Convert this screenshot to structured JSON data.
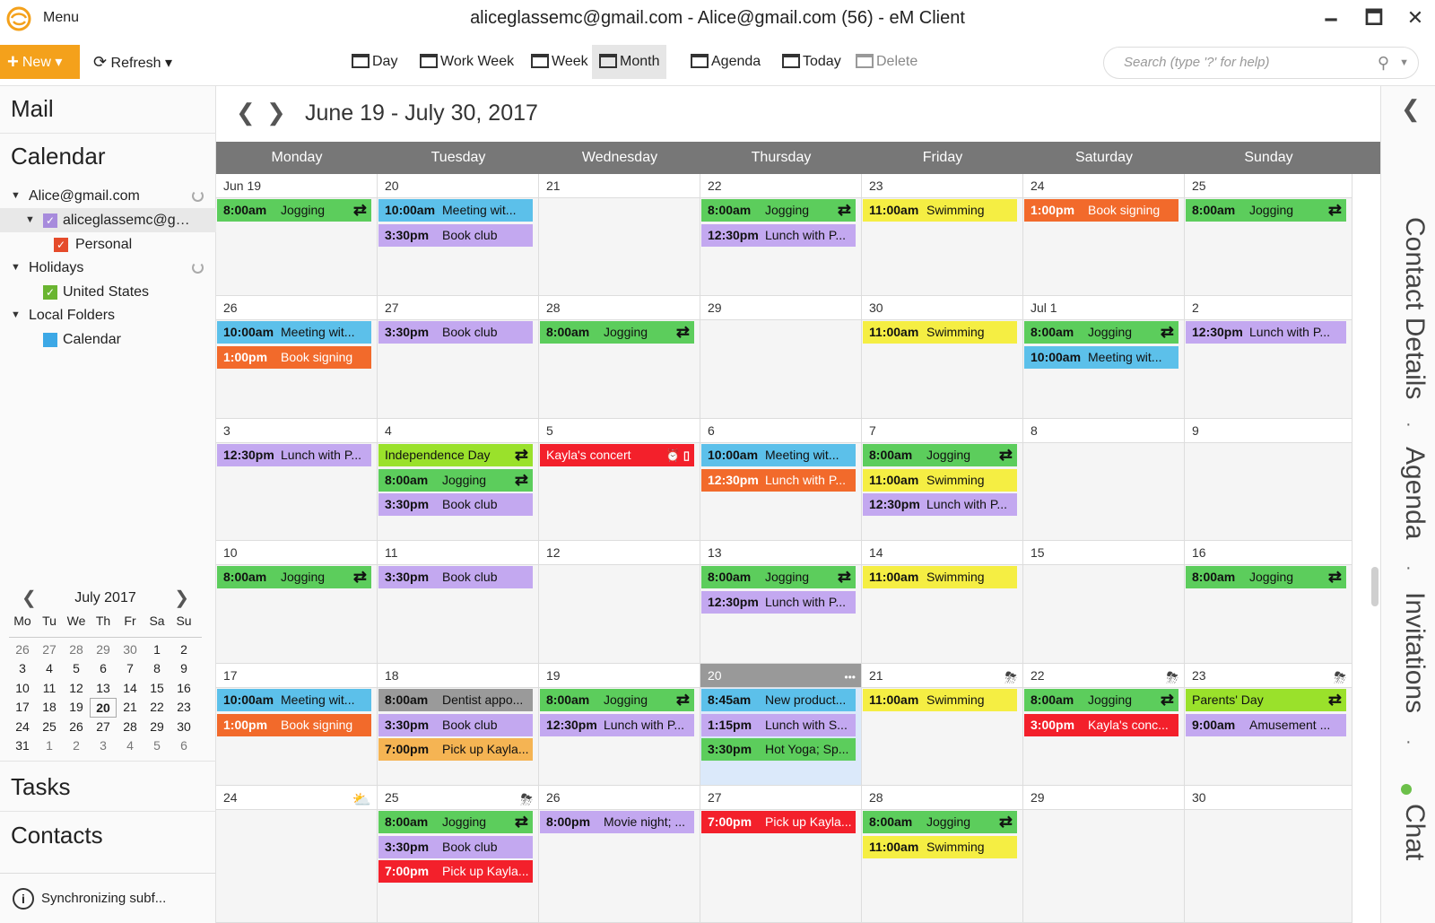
{
  "titlebar": {
    "menu": "Menu",
    "title": "aliceglassemc@gmail.com - Alice@gmail.com (56) - eM Client",
    "minimize": "🗕",
    "maximize": "🗖",
    "close": "✕"
  },
  "toolbar": {
    "new": "New",
    "refresh": "Refresh",
    "views": [
      {
        "label": "Day",
        "active": false
      },
      {
        "label": "Work Week",
        "active": false
      },
      {
        "label": "Week",
        "active": false
      },
      {
        "label": "Month",
        "active": true
      },
      {
        "label": "Agenda",
        "active": false
      },
      {
        "label": "Today",
        "active": false
      },
      {
        "label": "Delete",
        "active": false,
        "disabled": true
      }
    ],
    "search_placeholder": "Search (type '?' for help)"
  },
  "sidebar": {
    "mail": "Mail",
    "calendar": "Calendar",
    "tasks": "Tasks",
    "contacts": "Contacts",
    "tree": [
      {
        "label": "Alice@gmail.com",
        "level": 0,
        "expander": true,
        "spinner": true
      },
      {
        "label": "aliceglassemc@gmail.com",
        "level": 1,
        "expander": true,
        "check": "#a78bdc",
        "selected": true
      },
      {
        "label": "Personal",
        "level": 2,
        "check": "#e54b2b"
      },
      {
        "label": "Holidays",
        "level": 0,
        "expander": true,
        "spinner": true
      },
      {
        "label": "United States",
        "level": 1,
        "check": "#6ab531"
      },
      {
        "label": "Local Folders",
        "level": 0,
        "expander": true
      },
      {
        "label": "Calendar",
        "level": 1,
        "square": "#3ca8e6"
      }
    ],
    "status": "Synchronizing subf...",
    "mini": {
      "title": "July 2017",
      "dow": [
        "Mo",
        "Tu",
        "We",
        "Th",
        "Fr",
        "Sa",
        "Su"
      ],
      "days": [
        "26",
        "27",
        "28",
        "29",
        "30",
        "1",
        "2",
        "3",
        "4",
        "5",
        "6",
        "7",
        "8",
        "9",
        "10",
        "11",
        "12",
        "13",
        "14",
        "15",
        "16",
        "17",
        "18",
        "19",
        "20",
        "21",
        "22",
        "23",
        "24",
        "25",
        "26",
        "27",
        "28",
        "29",
        "30",
        "31",
        "1",
        "2",
        "3",
        "4",
        "5",
        "6"
      ],
      "other_before": 5,
      "other_after_index": 36,
      "today_index": 24
    }
  },
  "calendar": {
    "range": "June 19 - July 30, 2017",
    "dow": [
      "Monday",
      "Tuesday",
      "Wednesday",
      "Thursday",
      "Friday",
      "Saturday",
      "Sunday"
    ],
    "colors": {
      "green": "#5ccd5c",
      "blue": "#5cc0ea",
      "purple": "#c3a8f0",
      "yellow": "#f5ee43",
      "orange": "#f26a2b",
      "red": "#f3202b",
      "lime": "#9ae12b",
      "gray": "#9a9a9a",
      "peach": "#f5b453"
    },
    "weeks": [
      [
        {
          "d": "Jun 19",
          "ev": [
            {
              "t": "8:00am",
              "x": "Jogging",
              "c": "green",
              "r": 1
            }
          ]
        },
        {
          "d": "20",
          "ev": [
            {
              "t": "10:00am",
              "x": "Meeting wit...",
              "c": "blue"
            },
            {
              "t": "3:30pm",
              "x": "Book club",
              "c": "purple"
            }
          ]
        },
        {
          "d": "21",
          "ev": []
        },
        {
          "d": "22",
          "ev": [
            {
              "t": "8:00am",
              "x": "Jogging",
              "c": "green",
              "r": 1
            },
            {
              "t": "12:30pm",
              "x": "Lunch with P...",
              "c": "purple"
            }
          ]
        },
        {
          "d": "23",
          "ev": [
            {
              "t": "11:00am",
              "x": "Swimming",
              "c": "yellow"
            }
          ]
        },
        {
          "d": "24",
          "ev": [
            {
              "t": "1:00pm",
              "x": "Book signing",
              "c": "orange"
            }
          ]
        },
        {
          "d": "25",
          "ev": [
            {
              "t": "8:00am",
              "x": "Jogging",
              "c": "green",
              "r": 1
            }
          ]
        }
      ],
      [
        {
          "d": "26",
          "ev": [
            {
              "t": "10:00am",
              "x": "Meeting wit...",
              "c": "blue"
            },
            {
              "t": "1:00pm",
              "x": "Book signing",
              "c": "orange"
            }
          ]
        },
        {
          "d": "27",
          "ev": [
            {
              "t": "3:30pm",
              "x": "Book club",
              "c": "purple"
            }
          ]
        },
        {
          "d": "28",
          "ev": [
            {
              "t": "8:00am",
              "x": "Jogging",
              "c": "green",
              "r": 1
            }
          ]
        },
        {
          "d": "29",
          "ev": []
        },
        {
          "d": "30",
          "ev": [
            {
              "t": "11:00am",
              "x": "Swimming",
              "c": "yellow"
            }
          ]
        },
        {
          "d": "Jul 1",
          "ev": [
            {
              "t": "8:00am",
              "x": "Jogging",
              "c": "green",
              "r": 1
            },
            {
              "t": "10:00am",
              "x": "Meeting wit...",
              "c": "blue"
            }
          ]
        },
        {
          "d": "2",
          "ev": [
            {
              "t": "12:30pm",
              "x": "Lunch with P...",
              "c": "purple"
            }
          ]
        }
      ],
      [
        {
          "d": "3",
          "ev": [
            {
              "t": "12:30pm",
              "x": "Lunch with P...",
              "c": "purple"
            }
          ]
        },
        {
          "d": "4",
          "ev": [
            {
              "t": "",
              "x": "Independence Day",
              "c": "lime",
              "r": 1
            },
            {
              "t": "8:00am",
              "x": "Jogging",
              "c": "green",
              "r": 1
            },
            {
              "t": "3:30pm",
              "x": "Book club",
              "c": "purple"
            }
          ]
        },
        {
          "d": "5",
          "ev": [
            {
              "t": "",
              "x": "Kayla's concert",
              "c": "red",
              "alarm": 1
            }
          ]
        },
        {
          "d": "6",
          "ev": [
            {
              "t": "10:00am",
              "x": "Meeting wit...",
              "c": "blue"
            },
            {
              "t": "12:30pm",
              "x": "Lunch with P...",
              "c": "orange"
            }
          ]
        },
        {
          "d": "7",
          "ev": [
            {
              "t": "8:00am",
              "x": "Jogging",
              "c": "green",
              "r": 1
            },
            {
              "t": "11:00am",
              "x": "Swimming",
              "c": "yellow"
            },
            {
              "t": "12:30pm",
              "x": "Lunch with P...",
              "c": "purple"
            }
          ]
        },
        {
          "d": "8",
          "ev": []
        },
        {
          "d": "9",
          "ev": []
        }
      ],
      [
        {
          "d": "10",
          "ev": [
            {
              "t": "8:00am",
              "x": "Jogging",
              "c": "green",
              "r": 1
            }
          ]
        },
        {
          "d": "11",
          "ev": [
            {
              "t": "3:30pm",
              "x": "Book club",
              "c": "purple"
            }
          ]
        },
        {
          "d": "12",
          "ev": []
        },
        {
          "d": "13",
          "ev": [
            {
              "t": "8:00am",
              "x": "Jogging",
              "c": "green",
              "r": 1
            },
            {
              "t": "12:30pm",
              "x": "Lunch with P...",
              "c": "purple"
            }
          ]
        },
        {
          "d": "14",
          "ev": [
            {
              "t": "11:00am",
              "x": "Swimming",
              "c": "yellow"
            }
          ]
        },
        {
          "d": "15",
          "ev": []
        },
        {
          "d": "16",
          "ev": [
            {
              "t": "8:00am",
              "x": "Jogging",
              "c": "green",
              "r": 1
            }
          ]
        }
      ],
      [
        {
          "d": "17",
          "ev": [
            {
              "t": "10:00am",
              "x": "Meeting wit...",
              "c": "blue"
            },
            {
              "t": "1:00pm",
              "x": "Book signing",
              "c": "orange"
            }
          ]
        },
        {
          "d": "18",
          "ev": [
            {
              "t": "8:00am",
              "x": "Dentist appo...",
              "c": "gray"
            },
            {
              "t": "3:30pm",
              "x": "Book club",
              "c": "purple"
            },
            {
              "t": "7:00pm",
              "x": "Pick up Kayla...",
              "c": "peach"
            }
          ]
        },
        {
          "d": "19",
          "ev": [
            {
              "t": "8:00am",
              "x": "Jogging",
              "c": "green",
              "r": 1
            },
            {
              "t": "12:30pm",
              "x": "Lunch with P...",
              "c": "purple"
            }
          ]
        },
        {
          "d": "20",
          "today": true,
          "more": "•••",
          "ev": [
            {
              "t": "8:45am",
              "x": "New product...",
              "c": "blue"
            },
            {
              "t": "1:15pm",
              "x": "Lunch with S...",
              "c": "purple"
            },
            {
              "t": "3:30pm",
              "x": "Hot Yoga; Sp...",
              "c": "green"
            }
          ]
        },
        {
          "d": "21",
          "wx": "⛈",
          "ev": [
            {
              "t": "11:00am",
              "x": "Swimming",
              "c": "yellow"
            }
          ]
        },
        {
          "d": "22",
          "wx": "⛈",
          "ev": [
            {
              "t": "8:00am",
              "x": "Jogging",
              "c": "green",
              "r": 1
            },
            {
              "t": "3:00pm",
              "x": "Kayla's conc...",
              "c": "red"
            }
          ]
        },
        {
          "d": "23",
          "wx": "⛈",
          "ev": [
            {
              "t": "",
              "x": "Parents' Day",
              "c": "lime",
              "r": 1
            },
            {
              "t": "9:00am",
              "x": "Amusement ...",
              "c": "purple"
            }
          ]
        }
      ],
      [
        {
          "d": "24",
          "wx": "⛅",
          "ev": []
        },
        {
          "d": "25",
          "wx": "⛈",
          "ev": [
            {
              "t": "8:00am",
              "x": "Jogging",
              "c": "green",
              "r": 1
            },
            {
              "t": "3:30pm",
              "x": "Book club",
              "c": "purple"
            },
            {
              "t": "7:00pm",
              "x": "Pick up Kayla...",
              "c": "red"
            }
          ]
        },
        {
          "d": "26",
          "ev": [
            {
              "t": "8:00pm",
              "x": "Movie night; ...",
              "c": "purple"
            }
          ]
        },
        {
          "d": "27",
          "ev": [
            {
              "t": "7:00pm",
              "x": "Pick up Kayla...",
              "c": "red"
            }
          ]
        },
        {
          "d": "28",
          "ev": [
            {
              "t": "8:00am",
              "x": "Jogging",
              "c": "green",
              "r": 1
            },
            {
              "t": "11:00am",
              "x": "Swimming",
              "c": "yellow"
            }
          ]
        },
        {
          "d": "29",
          "ev": []
        },
        {
          "d": "30",
          "ev": []
        }
      ]
    ]
  },
  "rightbar": {
    "tabs": [
      "Contact Details",
      "Agenda",
      "Invitations",
      "Chat"
    ],
    "sep": "·"
  }
}
